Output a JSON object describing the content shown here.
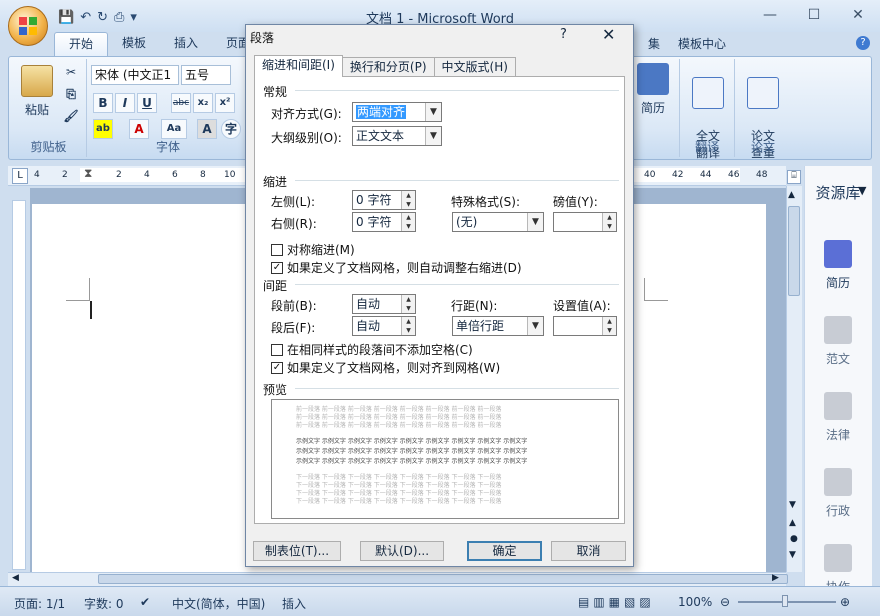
{
  "window": {
    "title": "文档 1 - Microsoft Word",
    "minimize": "—",
    "maximize": "☐",
    "close": "✕"
  },
  "ribbon": {
    "tabs": [
      "开始",
      "模板",
      "插入",
      "页面",
      "集",
      "模板中心"
    ],
    "groups": {
      "clipboard": "剪贴板",
      "font": "字体",
      "translate": "翻译",
      "paper": "论文"
    },
    "paste_label": "粘贴",
    "font_name": "宋体 (中文正1",
    "font_size": "五号",
    "format_buttons": [
      "B",
      "I",
      "U",
      "abc",
      "x₂",
      "x²"
    ],
    "resume_label": "简历",
    "fulltext_translate": "全文\n翻译",
    "paper_check": "论文\n查重"
  },
  "ruler": {
    "left_nums": [
      "4",
      "2"
    ],
    "mid_nums": [
      "2",
      "4",
      "6",
      "8",
      "10"
    ],
    "right_nums": [
      "40",
      "42",
      "44",
      "46",
      "48"
    ]
  },
  "right_pane": {
    "title": "资源库",
    "items": [
      "简历",
      "范文",
      "法律",
      "行政",
      "协作"
    ]
  },
  "status": {
    "page": "页面: 1/1",
    "words": "字数: 0",
    "lang": "中文(简体，中国)",
    "mode": "插入",
    "zoom": "100%"
  },
  "dialog": {
    "title": "段落",
    "help": "?",
    "close": "✕",
    "tabs": [
      "缩进和间距(I)",
      "换行和分页(P)",
      "中文版式(H)"
    ],
    "general": {
      "section": "常规",
      "align_label": "对齐方式(G):",
      "align_value": "两端对齐",
      "outline_label": "大纲级别(O):",
      "outline_value": "正文文本"
    },
    "indent": {
      "section": "缩进",
      "left_label": "左侧(L):",
      "left_value": "0 字符",
      "right_label": "右侧(R):",
      "right_value": "0 字符",
      "special_label": "特殊格式(S):",
      "special_value": "(无)",
      "by_label": "磅值(Y):",
      "by_value": "",
      "mirror": "对称缩进(M)",
      "auto_adjust": "如果定义了文档网格，则自动调整右缩进(D)"
    },
    "spacing": {
      "section": "间距",
      "before_label": "段前(B):",
      "before_value": "自动",
      "after_label": "段后(F):",
      "after_value": "自动",
      "line_label": "行距(N):",
      "line_value": "单倍行距",
      "at_label": "设置值(A):",
      "at_value": "",
      "no_space": "在相同样式的段落间不添加空格(C)",
      "snap_grid": "如果定义了文档网格，则对齐到网格(W)"
    },
    "preview": {
      "section": "预览",
      "prev_text": "前一段落 前一段落 前一段落 前一段落 前一段落 前一段落 前一段落 前一段落",
      "sample_text": "示例文字 示例文字 示例文字 示例文字 示例文字 示例文字 示例文字 示例文字 示例文字",
      "next_text": "下一段落 下一段落 下一段落 下一段落 下一段落 下一段落 下一段落 下一段落"
    },
    "buttons": {
      "tabs": "制表位(T)...",
      "default": "默认(D)...",
      "ok": "确定",
      "cancel": "取消"
    }
  }
}
